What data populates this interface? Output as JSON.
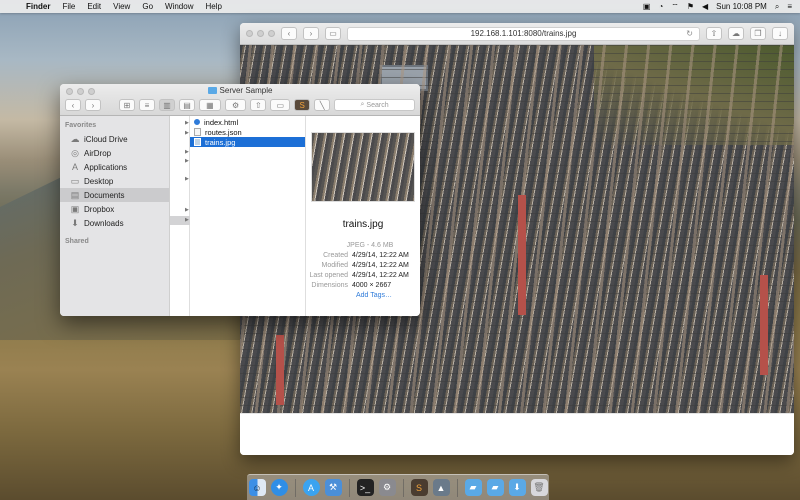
{
  "menubar": {
    "apple": "",
    "app_name": "Finder",
    "menus": [
      "File",
      "Edit",
      "View",
      "Go",
      "Window",
      "Help"
    ],
    "clock": "Sun 10:08 PM"
  },
  "safari": {
    "url": "192.168.1.101:8080/trains.jpg"
  },
  "finder": {
    "title": "Server Sample",
    "search_placeholder": "Search",
    "sidebar": {
      "favorites_heading": "Favorites",
      "items": [
        {
          "label": "iCloud Drive",
          "icon": "cloud-icon"
        },
        {
          "label": "AirDrop",
          "icon": "airdrop-icon"
        },
        {
          "label": "Applications",
          "icon": "applications-icon"
        },
        {
          "label": "Desktop",
          "icon": "desktop-icon"
        },
        {
          "label": "Documents",
          "icon": "documents-icon"
        },
        {
          "label": "Dropbox",
          "icon": "dropbox-icon"
        },
        {
          "label": "Downloads",
          "icon": "downloads-icon"
        }
      ],
      "shared_heading": "Shared"
    },
    "files": [
      "index.html",
      "routes.json",
      "trains.jpg"
    ],
    "preview": {
      "name": "trains.jpg",
      "kind": "JPEG - 4.6 MB",
      "rows": [
        {
          "key": "Created",
          "value": "4/29/14, 12:22 AM"
        },
        {
          "key": "Modified",
          "value": "4/29/14, 12:22 AM"
        },
        {
          "key": "Last opened",
          "value": "4/29/14, 12:22 AM"
        },
        {
          "key": "Dimensions",
          "value": "4000 × 2667"
        }
      ],
      "add_tags": "Add Tags…"
    }
  },
  "colors": {
    "selection": "#1c6fd6",
    "link": "#2f7bd9"
  }
}
